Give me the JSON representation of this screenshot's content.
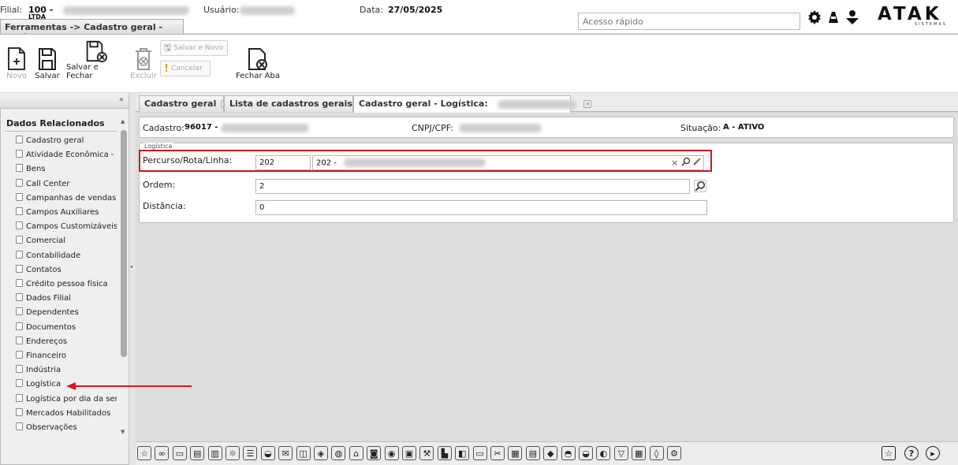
{
  "header": {
    "filial_label": "Filial:",
    "filial_value": "100 -",
    "filial_suffix": "LTDA",
    "usuario_label": "Usuário:",
    "data_label": "Data:",
    "data_value": "27/05/2025",
    "quick_access_placeholder": "Acesso rápido",
    "logo_text": "ATAK",
    "logo_sub": "SISTEMAS"
  },
  "title_tab": "Ferramentas -> Cadastro geral - Logística",
  "toolbar": {
    "novo": "Novo",
    "salvar": "Salvar",
    "salvar_fechar": "Salvar e Fechar",
    "excluir": "Excluir",
    "salvar_novo": "Salvar e Novo",
    "cancelar": "Cancelar",
    "fechar_aba": "Fechar Aba"
  },
  "sidebar": {
    "collapse_glyph": "«",
    "title": "Dados Relacionados",
    "items": [
      "Cadastro geral",
      "Atividade Econômica - CNAE",
      "Bens",
      "Call Center",
      "Campanhas de vendas",
      "Campos Auxiliares",
      "Campos Customizáveis",
      "Comercial",
      "Contabilidade",
      "Contatos",
      "Crédito pessoa física",
      "Dados Filial",
      "Dependentes",
      "Documentos",
      "Endereços",
      "Financeiro",
      "Indústria",
      "Logística",
      "Logística por dia da semana",
      "Mercados Habilitados",
      "Observações"
    ]
  },
  "tabs": [
    {
      "label": "Cadastro geral"
    },
    {
      "label": "Lista de cadastros gerais"
    },
    {
      "label": "Cadastro geral - Logística:"
    }
  ],
  "record": {
    "cadastro_label": "Cadastro:",
    "cadastro_value": "96017 -",
    "cnpj_label": "CNPJ/CPF:",
    "situacao_label": "Situação:",
    "situacao_value": "A - ATIVO"
  },
  "logistica": {
    "group_label": "Logística",
    "percurso_label": "Percurso/Rota/Linha:",
    "percurso_code": "202",
    "percurso_desc": "202 -",
    "ordem_label": "Ordem:",
    "ordem_value": "2",
    "distancia_label": "Distância:",
    "distancia_value": "0"
  },
  "colors": {
    "highlight_border": "#d0151c",
    "arrow": "#e0141c"
  }
}
